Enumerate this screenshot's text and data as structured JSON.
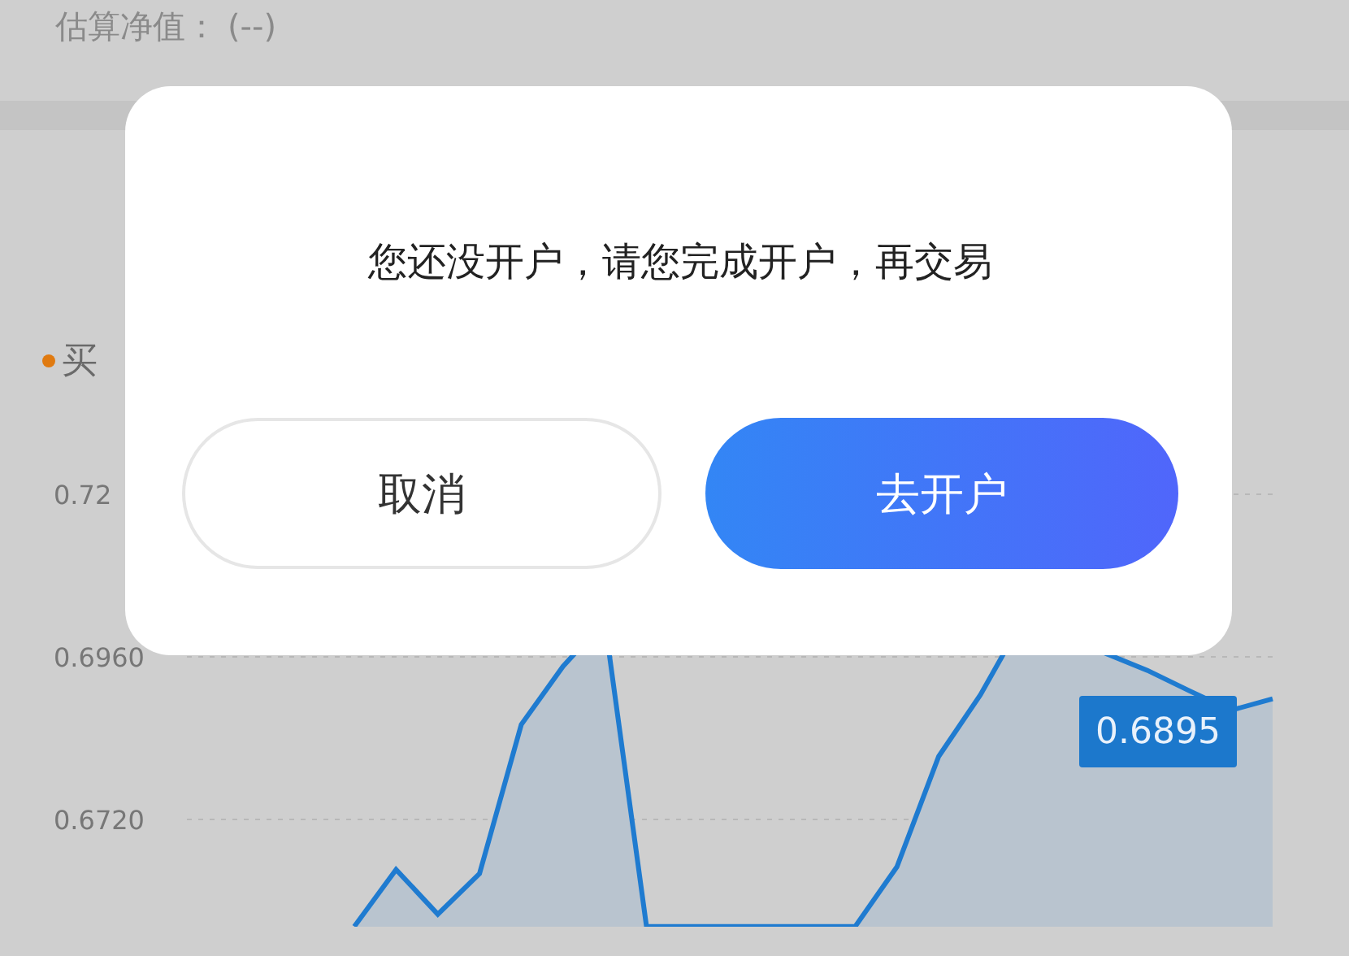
{
  "header": {
    "label": "估算净值：",
    "value": "(--)"
  },
  "legend": {
    "label": "买",
    "color": "#e07a10"
  },
  "chart": {
    "y_axis_labels": [
      "0.72",
      "0.6960",
      "0.6720"
    ],
    "tooltip": "0.6895"
  },
  "dialog": {
    "message": "您还没开户，请您完成开户，再交易",
    "buttons": [
      {
        "label": "取消",
        "kind": "secondary"
      },
      {
        "label": "去开户",
        "kind": "primary"
      }
    ]
  }
}
